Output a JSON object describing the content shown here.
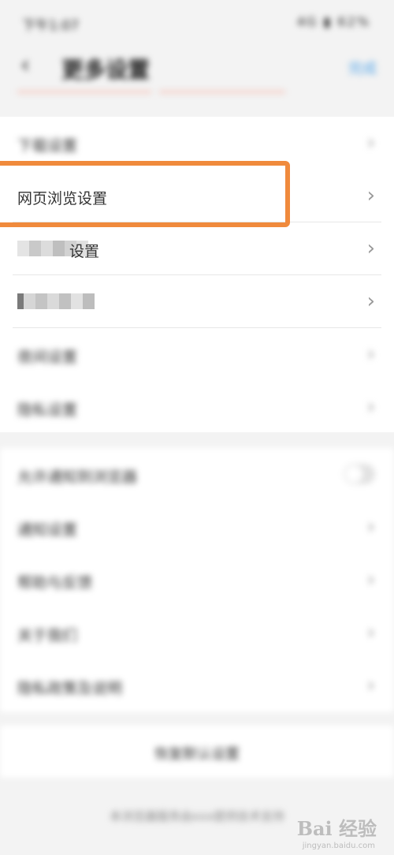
{
  "status_bar": {
    "time": "下午1:07",
    "icons": "4G ▮ 62%"
  },
  "header": {
    "back_icon": "chevron-left",
    "title": "更多设置",
    "action": "完成"
  },
  "group1": [
    {
      "label": "下载设置",
      "blurred": true
    },
    {
      "label": "网页浏览设置",
      "blurred": false
    },
    {
      "label": "设置",
      "blurred": "partial"
    },
    {
      "label": "",
      "blurred": "pixelated"
    },
    {
      "label": "夜间设置",
      "blurred": true
    },
    {
      "label": "隐私设置",
      "blurred": true
    }
  ],
  "group2": [
    {
      "label": "允许通知到浏览器",
      "control": "toggle"
    },
    {
      "label": "通知设置",
      "control": "chevron"
    },
    {
      "label": "帮助与反馈",
      "control": "chevron"
    },
    {
      "label": "关于我们",
      "control": "chevron"
    },
    {
      "label": "隐私政策及说明",
      "control": "chevron"
    }
  ],
  "bottom_button": "恢复默认设置",
  "footer": "本浏览器服务由xxx提供技术支持",
  "watermark": {
    "brand": "Bai 经验",
    "url": "jingyan.baidu.com"
  },
  "colors": {
    "highlight": "#f08a3c",
    "link": "#5aa8e8"
  }
}
